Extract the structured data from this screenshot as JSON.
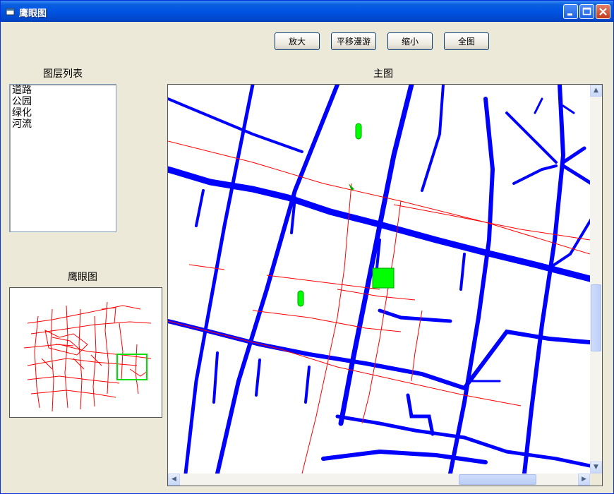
{
  "window": {
    "title": "鹰眼图",
    "colors": {
      "titlebar": "#0054e3",
      "face": "#ece9d8"
    }
  },
  "toolbar": {
    "zoom_in": "放大",
    "pan": "平移漫游",
    "zoom_out": "缩小",
    "full_extent": "全图"
  },
  "layers": {
    "title": "图层列表",
    "items": [
      "道路",
      "公园",
      "绿化",
      "河流"
    ]
  },
  "overview": {
    "title": "鹰眼图",
    "extent_color": "#00dd00",
    "road_color": "#ff0000"
  },
  "main_map": {
    "title": "主图",
    "road_color": "#0000ff",
    "line_color": "#ff0000",
    "park_color": "#00ff00"
  }
}
